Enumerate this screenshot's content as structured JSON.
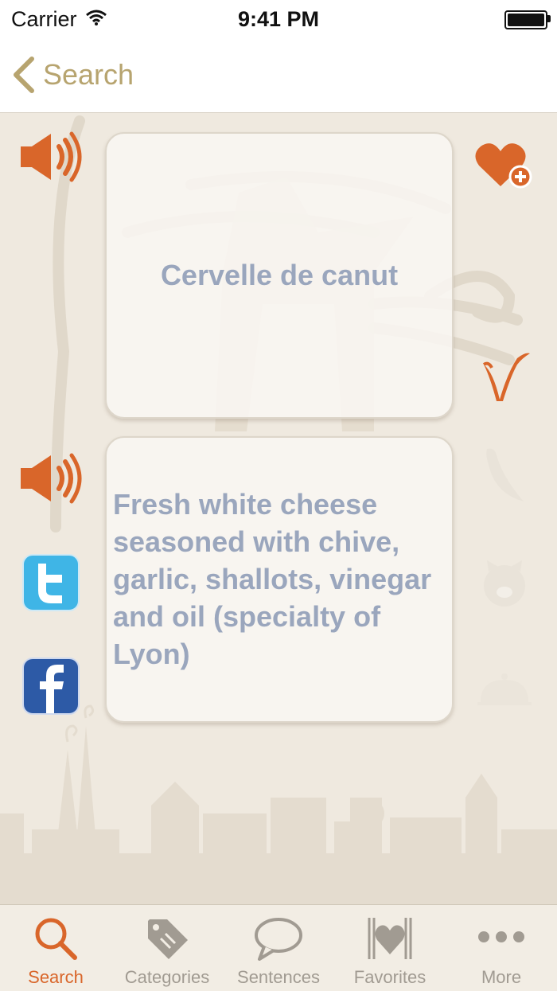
{
  "status_bar": {
    "carrier": "Carrier",
    "time": "9:41 PM"
  },
  "nav": {
    "back_label": "Search"
  },
  "dish": {
    "name": "Cervelle de canut",
    "description": "Fresh white cheese seasoned with chive, garlic, shallots, vinegar and oil (specialty of Lyon)"
  },
  "tabs": [
    {
      "label": "Search",
      "icon": "search-icon",
      "active": true
    },
    {
      "label": "Categories",
      "icon": "tag-icon",
      "active": false
    },
    {
      "label": "Sentences",
      "icon": "speech-bubble-icon",
      "active": false
    },
    {
      "label": "Favorites",
      "icon": "heart-icon",
      "active": false
    },
    {
      "label": "More",
      "icon": "more-dots-icon",
      "active": false
    }
  ],
  "colors": {
    "accent": "#d9662a",
    "back_gold": "#b7a46f",
    "card_text": "#9aa6bd",
    "background": "#efe9df"
  }
}
